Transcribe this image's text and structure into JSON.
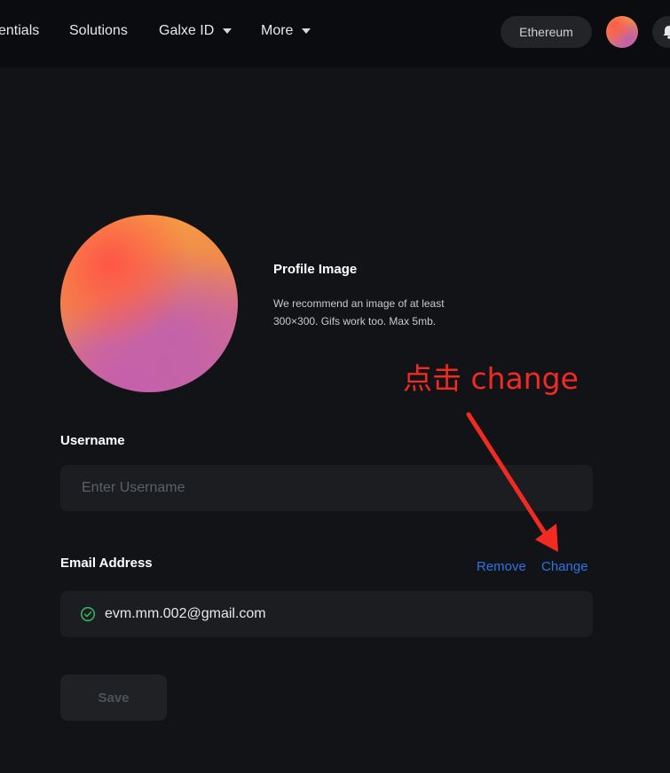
{
  "header": {
    "nav": [
      {
        "label": "entials",
        "has_dropdown": false
      },
      {
        "label": "Solutions",
        "has_dropdown": false
      },
      {
        "label": "Galxe ID",
        "has_dropdown": true
      },
      {
        "label": "More",
        "has_dropdown": true
      }
    ],
    "network_label": "Ethereum",
    "avatar_icon": "user-avatar-gradient",
    "bell_icon": "bell-icon"
  },
  "profile": {
    "title": "Profile Image",
    "description": "We recommend an image of at least 300×300. Gifs work too. Max 5mb."
  },
  "username": {
    "label": "Username",
    "placeholder": "Enter Username",
    "value": ""
  },
  "email": {
    "label": "Email Address",
    "remove_label": "Remove",
    "change_label": "Change",
    "value": "evm.mm.002@gmail.com",
    "verified_icon": "check-circle-icon"
  },
  "save_label": "Save",
  "annotation": {
    "text": "点击 change",
    "color": "#f22a22"
  },
  "colors": {
    "link": "#2b74e4",
    "verified": "#3bb05c",
    "background": "#121316",
    "header_bg": "#0b0c0f"
  }
}
